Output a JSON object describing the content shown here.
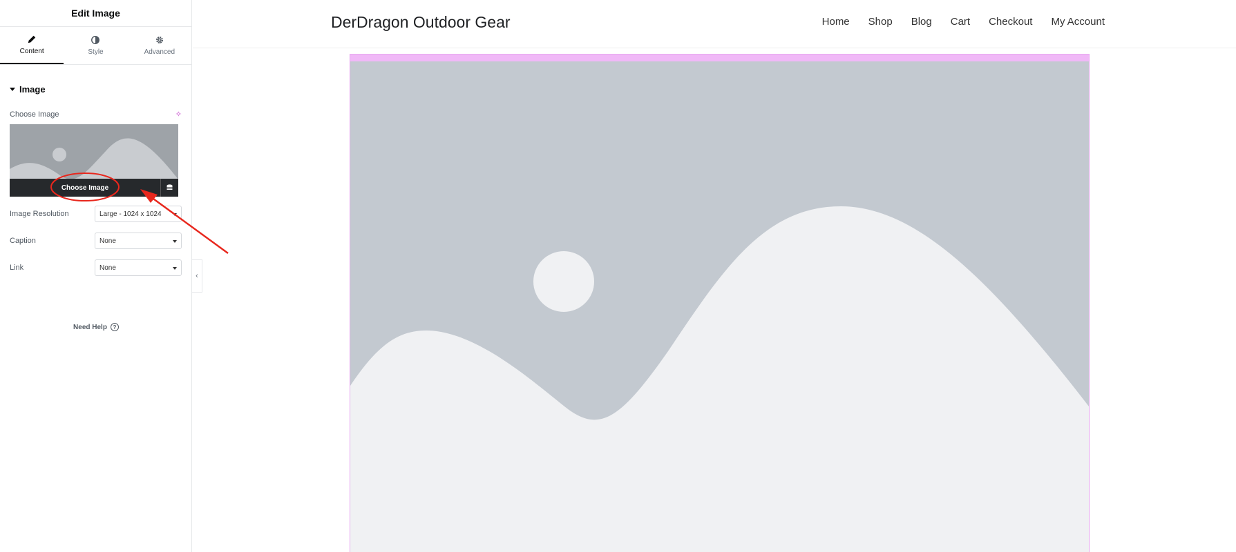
{
  "panel": {
    "title": "Edit Image",
    "tabs": [
      {
        "label": "Content",
        "icon": "pencil-icon"
      },
      {
        "label": "Style",
        "icon": "contrast-icon"
      },
      {
        "label": "Advanced",
        "icon": "gear-icon"
      }
    ],
    "section_title": "Image",
    "choose_label": "Choose Image",
    "media_button": "Choose Image",
    "controls": [
      {
        "label": "Image Resolution",
        "value": "Large - 1024 x 1024"
      },
      {
        "label": "Caption",
        "value": "None"
      },
      {
        "label": "Link",
        "value": "None"
      }
    ],
    "help": "Need Help",
    "help_icon": "?"
  },
  "site": {
    "title": "DerDragon Outdoor Gear",
    "nav": [
      "Home",
      "Shop",
      "Blog",
      "Cart",
      "Checkout",
      "My Account"
    ]
  },
  "colors": {
    "accent_pink": "#f0b8f7",
    "annotation_red": "#e8271d",
    "placeholder_sky": "#c3c9d0",
    "placeholder_land": "#f0f1f3"
  }
}
